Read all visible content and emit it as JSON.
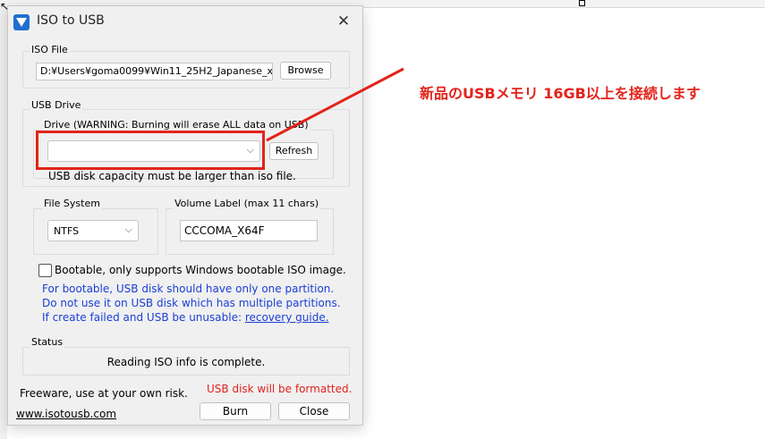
{
  "window": {
    "title": "ISO to USB"
  },
  "iso_file": {
    "group_label": "ISO File",
    "path": "D:¥Users¥goma0099¥Win11_25H2_Japanese_x",
    "browse_label": "Browse"
  },
  "usb_drive": {
    "group_label": "USB Drive",
    "drive_label": "Drive (WARNING: Burning will erase ALL data on USB)",
    "selected_drive": "",
    "refresh_label": "Refresh",
    "capacity_note": "USB disk capacity must be larger than iso file."
  },
  "file_system": {
    "group_label": "File System",
    "value": "NTFS"
  },
  "volume_label": {
    "group_label": "Volume Label (max 11 chars)",
    "value": "CCCOMA_X64F"
  },
  "bootable": {
    "checkbox_label": "Bootable, only supports Windows bootable ISO image.",
    "note_line1": "For bootable, USB disk should have only one partition.",
    "note_line2": "Do not use it on USB disk which has multiple partitions.",
    "note_line3_prefix": "If create failed and USB be unusable: ",
    "recovery_link": "recovery guide."
  },
  "status": {
    "group_label": "Status",
    "message": "Reading ISO info is complete."
  },
  "footer": {
    "freeware": "Freeware, use at your own risk.",
    "warning": "USB disk will be formatted.",
    "website": "www.isotousb.com",
    "burn_label": "Burn",
    "close_label": "Close"
  },
  "annotation": {
    "text": "新品のUSBメモリ 16GB以上を接続します"
  },
  "colors": {
    "accent": "#1f6fd1",
    "annotation_red": "#e3231a",
    "info_blue": "#1a3fd6"
  }
}
